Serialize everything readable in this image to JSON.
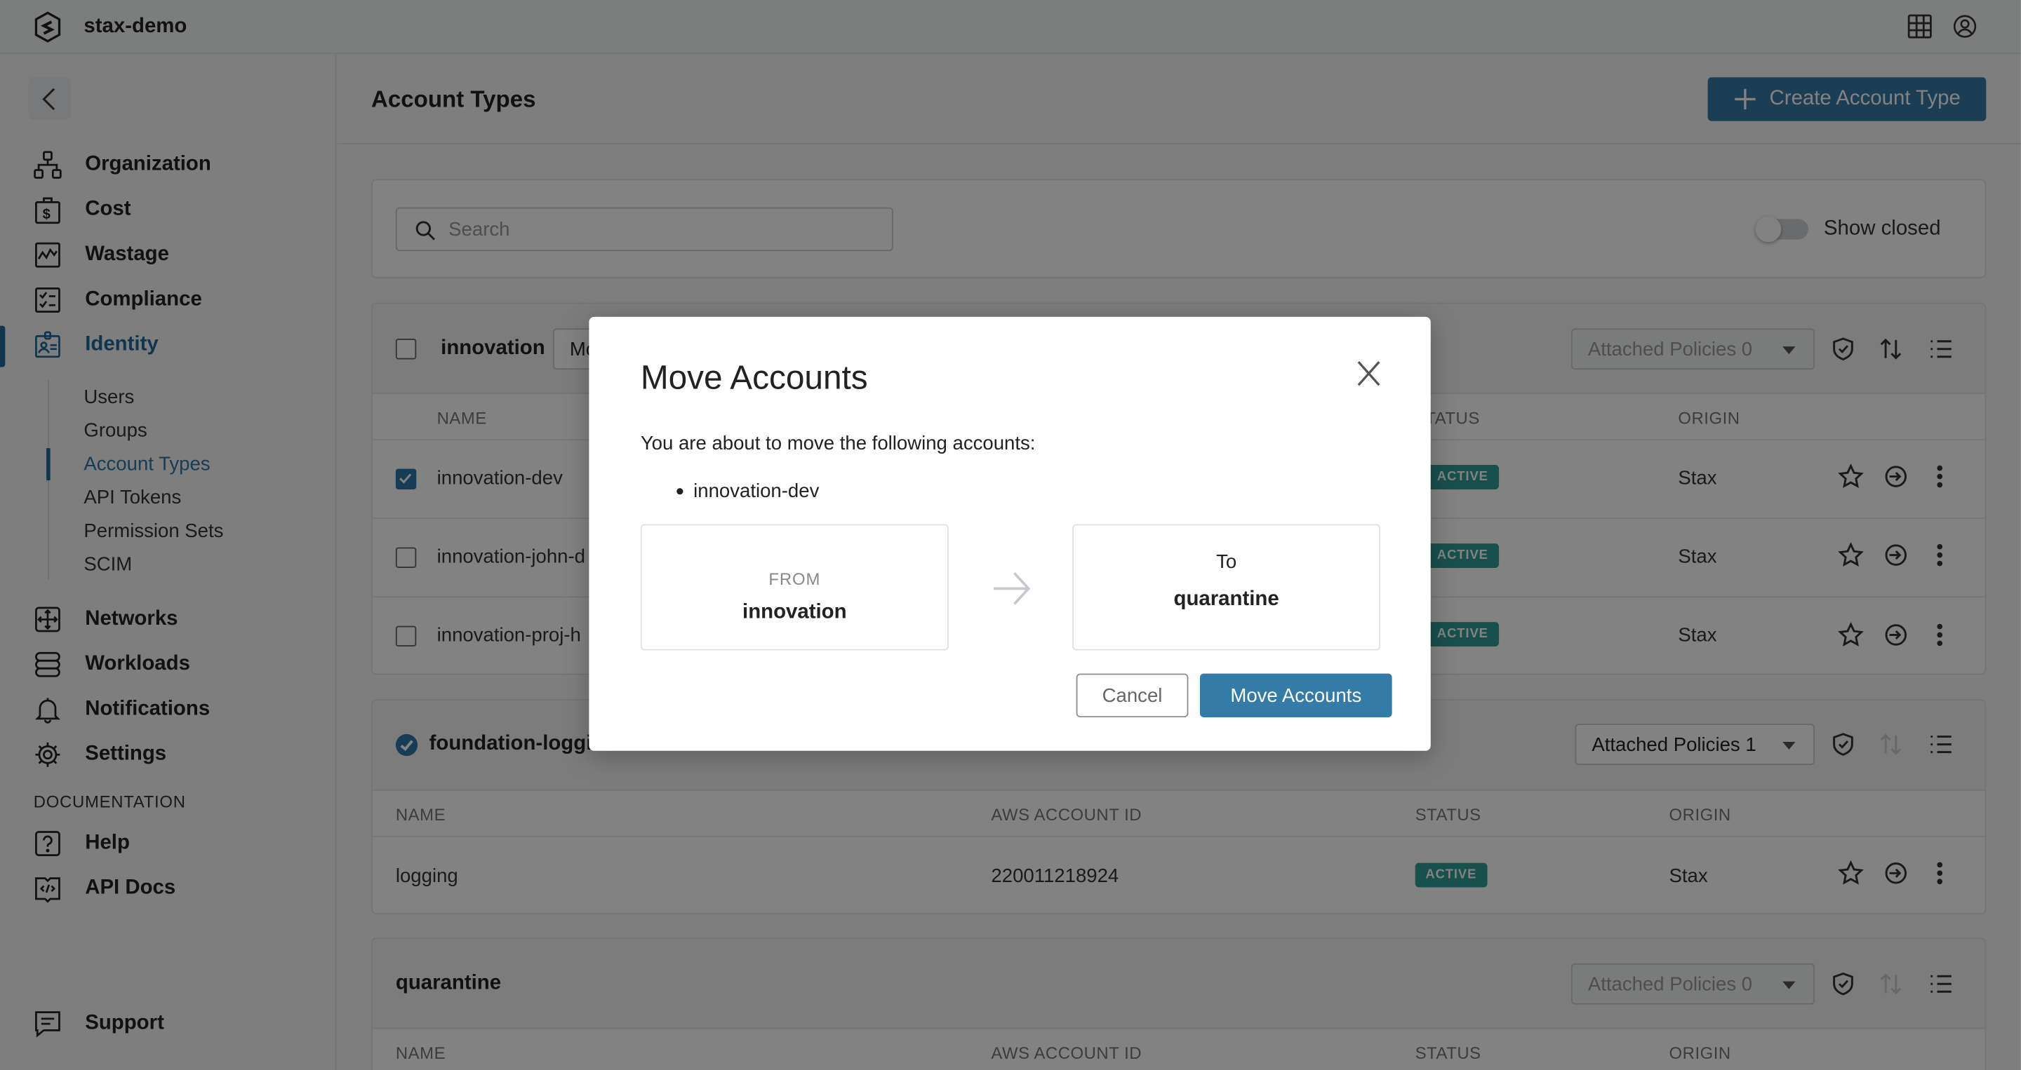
{
  "app": {
    "org_name": "stax-demo"
  },
  "sidebar": {
    "items": [
      {
        "label": "Organization",
        "icon": "org-chart-icon"
      },
      {
        "label": "Cost",
        "icon": "dollar-bag-icon"
      },
      {
        "label": "Wastage",
        "icon": "chart-line-icon"
      },
      {
        "label": "Compliance",
        "icon": "checklist-icon"
      },
      {
        "label": "Identity",
        "icon": "id-badge-icon",
        "active": true
      }
    ],
    "identity_sub": [
      "Users",
      "Groups",
      "Account Types",
      "API Tokens",
      "Permission Sets",
      "SCIM"
    ],
    "items2": [
      {
        "label": "Networks",
        "icon": "network-icon"
      },
      {
        "label": "Workloads",
        "icon": "workloads-icon"
      },
      {
        "label": "Notifications",
        "icon": "bell-icon"
      },
      {
        "label": "Settings",
        "icon": "gear-icon"
      }
    ],
    "documentation_heading": "DOCUMENTATION",
    "docs": [
      {
        "label": "Help",
        "icon": "help-icon"
      },
      {
        "label": "API Docs",
        "icon": "api-docs-icon"
      }
    ],
    "support": "Support"
  },
  "main": {
    "title": "Account Types",
    "create_button": "Create Account Type",
    "search_placeholder": "Search",
    "show_closed": "Show closed",
    "show_closed_on": false,
    "columns": {
      "name": "NAME",
      "aws": "AWS ACCOUNT ID",
      "status": "STATUS",
      "origin": "ORIGIN"
    },
    "groups": [
      {
        "name": "innovation",
        "move_select": "Mo",
        "policies": "Attached Policies 0",
        "rows": [
          {
            "name": "innovation-dev",
            "status": "ACTIVE",
            "origin": "Stax",
            "checked": true
          },
          {
            "name": "innovation-john-d",
            "status": "ACTIVE",
            "origin": "Stax",
            "checked": false
          },
          {
            "name": "innovation-proj-h",
            "status": "ACTIVE",
            "origin": "Stax",
            "checked": false
          }
        ]
      },
      {
        "name": "foundation-loggi",
        "policies": "Attached Policies 1",
        "rows": [
          {
            "name": "logging",
            "aws_id": "220011218924",
            "status": "ACTIVE",
            "origin": "Stax"
          }
        ]
      },
      {
        "name": "quarantine",
        "policies": "Attached Policies 0"
      }
    ]
  },
  "modal": {
    "title": "Move Accounts",
    "message": "You are about to move the following accounts:",
    "accounts": [
      "innovation-dev"
    ],
    "from_label": "FROM",
    "from_value": "innovation",
    "to_label": "To",
    "to_value": "quarantine",
    "cancel": "Cancel",
    "confirm": "Move Accounts"
  },
  "colors": {
    "primary": "#357ba8",
    "active_badge": "#2f9d98",
    "nav_active": "#1f6a99"
  }
}
